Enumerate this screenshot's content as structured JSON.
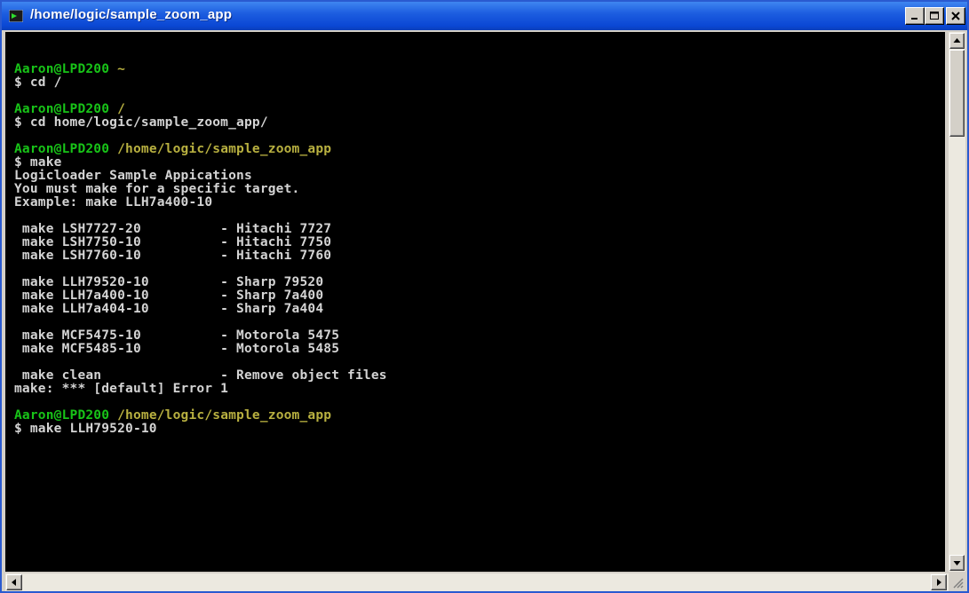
{
  "window": {
    "title": "/home/logic/sample_zoom_app"
  },
  "colors": {
    "prompt_user": "#18c418",
    "prompt_path": "#b8b040",
    "output_text": "#d4d4d4",
    "background": "#000000"
  },
  "terminal": {
    "lines": [
      {
        "user": "Aaron@LPD200",
        "path": " ~"
      },
      {
        "text": "$ cd /"
      },
      {
        "text": ""
      },
      {
        "user": "Aaron@LPD200",
        "path": " /"
      },
      {
        "text": "$ cd home/logic/sample_zoom_app/"
      },
      {
        "text": ""
      },
      {
        "user": "Aaron@LPD200",
        "path": " /home/logic/sample_zoom_app"
      },
      {
        "text": "$ make"
      },
      {
        "text": "Logicloader Sample Appications"
      },
      {
        "text": "You must make for a specific target."
      },
      {
        "text": "Example: make LLH7a400-10"
      },
      {
        "text": ""
      },
      {
        "text": " make LSH7727-20          - Hitachi 7727"
      },
      {
        "text": " make LSH7750-10          - Hitachi 7750"
      },
      {
        "text": " make LSH7760-10          - Hitachi 7760"
      },
      {
        "text": ""
      },
      {
        "text": " make LLH79520-10         - Sharp 79520"
      },
      {
        "text": " make LLH7a400-10         - Sharp 7a400"
      },
      {
        "text": " make LLH7a404-10         - Sharp 7a404"
      },
      {
        "text": ""
      },
      {
        "text": " make MCF5475-10          - Motorola 5475"
      },
      {
        "text": " make MCF5485-10          - Motorola 5485"
      },
      {
        "text": ""
      },
      {
        "text": " make clean               - Remove object files"
      },
      {
        "text": "make: *** [default] Error 1"
      },
      {
        "text": ""
      },
      {
        "user": "Aaron@LPD200",
        "path": " /home/logic/sample_zoom_app"
      },
      {
        "text": "$ make LLH79520-10"
      }
    ]
  }
}
